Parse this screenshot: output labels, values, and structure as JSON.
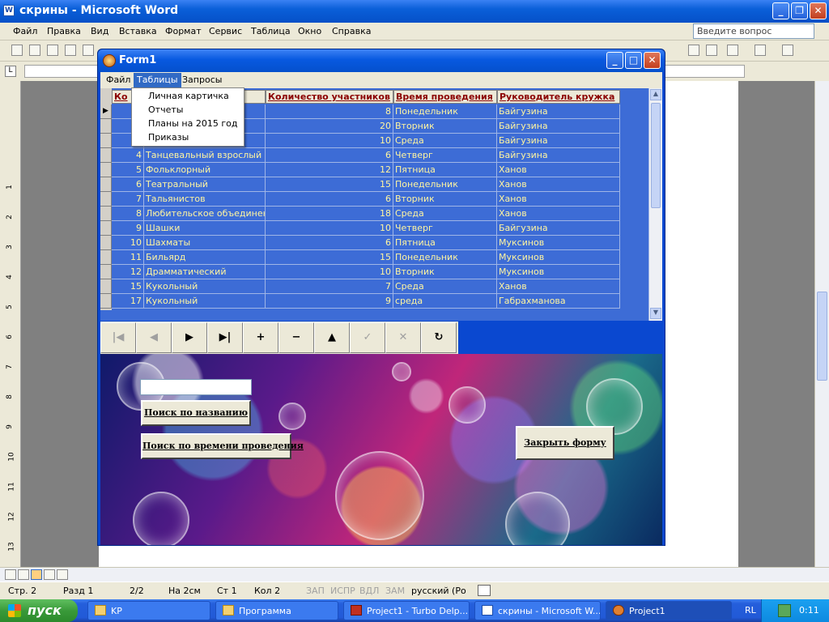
{
  "word": {
    "title": "скрины - Microsoft Word",
    "menu": [
      "Файл",
      "Правка",
      "Вид",
      "Вставка",
      "Формат",
      "Сервис",
      "Таблица",
      "Окно",
      "Справка"
    ],
    "help_placeholder": "Введите вопрос",
    "ruler_numbers": [
      "1",
      "2",
      "3",
      "4",
      "5",
      "6",
      "7",
      "8",
      "9",
      "10",
      "11",
      "12",
      "13"
    ],
    "status": {
      "page": "Стр. 2",
      "section": "Разд 1",
      "pages": "2/2",
      "at": "На 2см",
      "line": "Ст 1",
      "col": "Кол 2",
      "rec": "ЗАП",
      "trk": "ИСПР",
      "ext": "ВДЛ",
      "ovr": "ЗАМ",
      "lang": "русский (Ро"
    }
  },
  "taskbar": {
    "start": "пуск",
    "tasks": [
      "KP",
      "Программа",
      "Project1 - Turbo Delp...",
      "скрины - Microsoft W...",
      "Project1"
    ],
    "lang": "RL",
    "clock": "0:11"
  },
  "form1": {
    "title": "Form1",
    "menu": [
      "Файл",
      "Таблицы",
      "Запросы"
    ],
    "dropdown": [
      "Личная картичка",
      "Отчеты",
      "Планы на 2015 год",
      "Приказы"
    ],
    "grid": {
      "headers": [
        "Ко",
        "Количество участников",
        "Время проведения",
        "Руководитель кружка"
      ],
      "rows": [
        {
          "id": "",
          "name": "",
          "count": "8",
          "day": "Понедельник",
          "leader": "Байгузина"
        },
        {
          "id": "",
          "name": "",
          "count": "20",
          "day": "Вторник",
          "leader": "Байгузина"
        },
        {
          "id": "",
          "name": "",
          "count": "10",
          "day": "Среда",
          "leader": "Байгузина"
        },
        {
          "id": "4",
          "name": "Танцевальный взрослый",
          "count": "6",
          "day": "Четверг",
          "leader": "Байгузина"
        },
        {
          "id": "5",
          "name": "Фольклорный",
          "count": "12",
          "day": "Пятница",
          "leader": "Ханов"
        },
        {
          "id": "6",
          "name": "Театральный",
          "count": "15",
          "day": "Понедельник",
          "leader": "Ханов"
        },
        {
          "id": "7",
          "name": "Тальянистов",
          "count": "6",
          "day": "Вторник",
          "leader": "Ханов"
        },
        {
          "id": "8",
          "name": "Любительское объединение",
          "count": "18",
          "day": "Среда",
          "leader": "Ханов"
        },
        {
          "id": "9",
          "name": "Шашки",
          "count": "10",
          "day": "Четверг",
          "leader": "Байгузина"
        },
        {
          "id": "10",
          "name": "Шахматы",
          "count": "6",
          "day": "Пятница",
          "leader": "Муксинов"
        },
        {
          "id": "11",
          "name": "Бильярд",
          "count": "15",
          "day": "Понедельник",
          "leader": "Муксинов"
        },
        {
          "id": "12",
          "name": "Драмматический",
          "count": "10",
          "day": "Вторник",
          "leader": "Муксинов"
        },
        {
          "id": "15",
          "name": "Кукольный",
          "count": "7",
          "day": "Среда",
          "leader": "Ханов"
        },
        {
          "id": "17",
          "name": "Кукольный",
          "count": "9",
          "day": "среда",
          "leader": "Габрахманова"
        }
      ]
    },
    "navigator": [
      {
        "name": "nav-first-button",
        "glyph": "|◀",
        "enabled": false
      },
      {
        "name": "nav-prior-button",
        "glyph": "◀",
        "enabled": false
      },
      {
        "name": "nav-next-button",
        "glyph": "▶",
        "enabled": true
      },
      {
        "name": "nav-last-button",
        "glyph": "▶|",
        "enabled": true
      },
      {
        "name": "nav-insert-button",
        "glyph": "+",
        "enabled": true
      },
      {
        "name": "nav-delete-button",
        "glyph": "−",
        "enabled": true
      },
      {
        "name": "nav-edit-button",
        "glyph": "▲",
        "enabled": true
      },
      {
        "name": "nav-post-button",
        "glyph": "✓",
        "enabled": false
      },
      {
        "name": "nav-cancel-button",
        "glyph": "✕",
        "enabled": false
      },
      {
        "name": "nav-refresh-button",
        "glyph": "↻",
        "enabled": true
      }
    ],
    "search_value": "",
    "search_by_name": "Поиск по названию",
    "search_by_time": "Поиск по времени проведения",
    "close_form": "Закрыть форму"
  },
  "colors": {
    "grid_bg": "#3d6cd6",
    "grid_text": "#fff5a0",
    "header_text": "#8b0000",
    "xp_blue": "#0550cc"
  }
}
